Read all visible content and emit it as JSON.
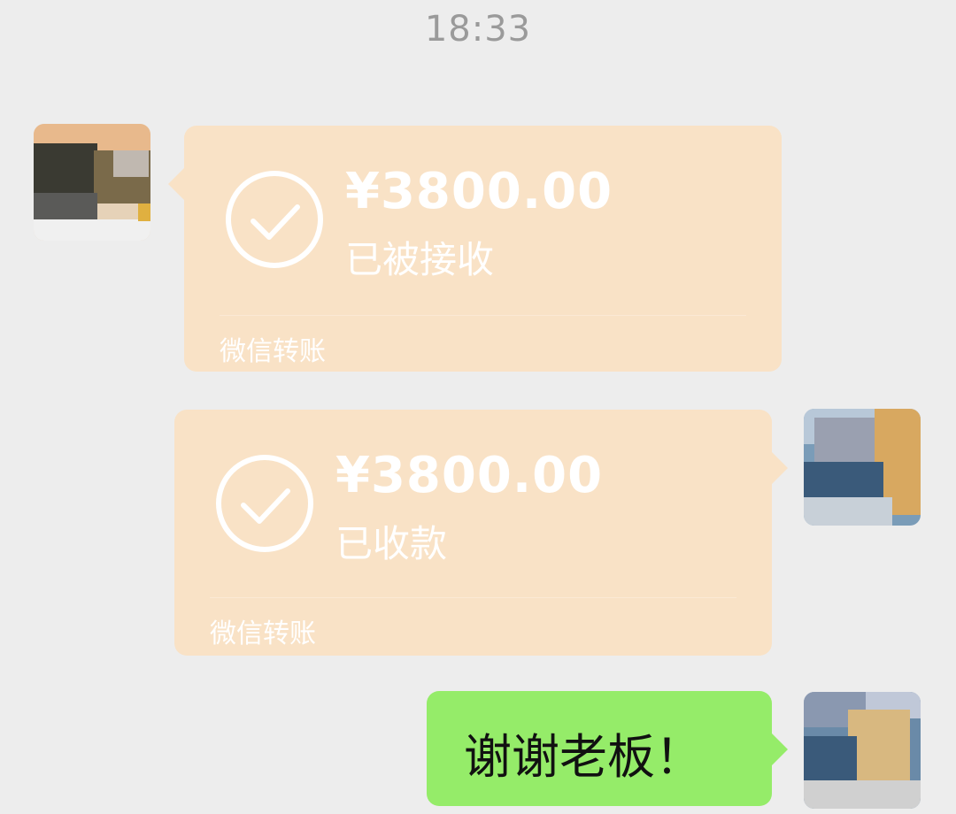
{
  "time": "18:33",
  "messages": [
    {
      "side": "left",
      "type": "transfer",
      "amount": "¥3800.00",
      "status": "已被接收",
      "footer": "微信转账"
    },
    {
      "side": "right",
      "type": "transfer",
      "amount": "¥3800.00",
      "status": "已收款",
      "footer": "微信转账"
    },
    {
      "side": "right",
      "type": "text",
      "text": "谢谢老板！"
    }
  ],
  "colors": {
    "background": "#ededed",
    "transfer_bubble": "#f9e2c6",
    "text_bubble": "#95ec69",
    "timestamp": "#9a9a9a"
  },
  "icons": [
    "check-circle-icon",
    "avatar"
  ]
}
